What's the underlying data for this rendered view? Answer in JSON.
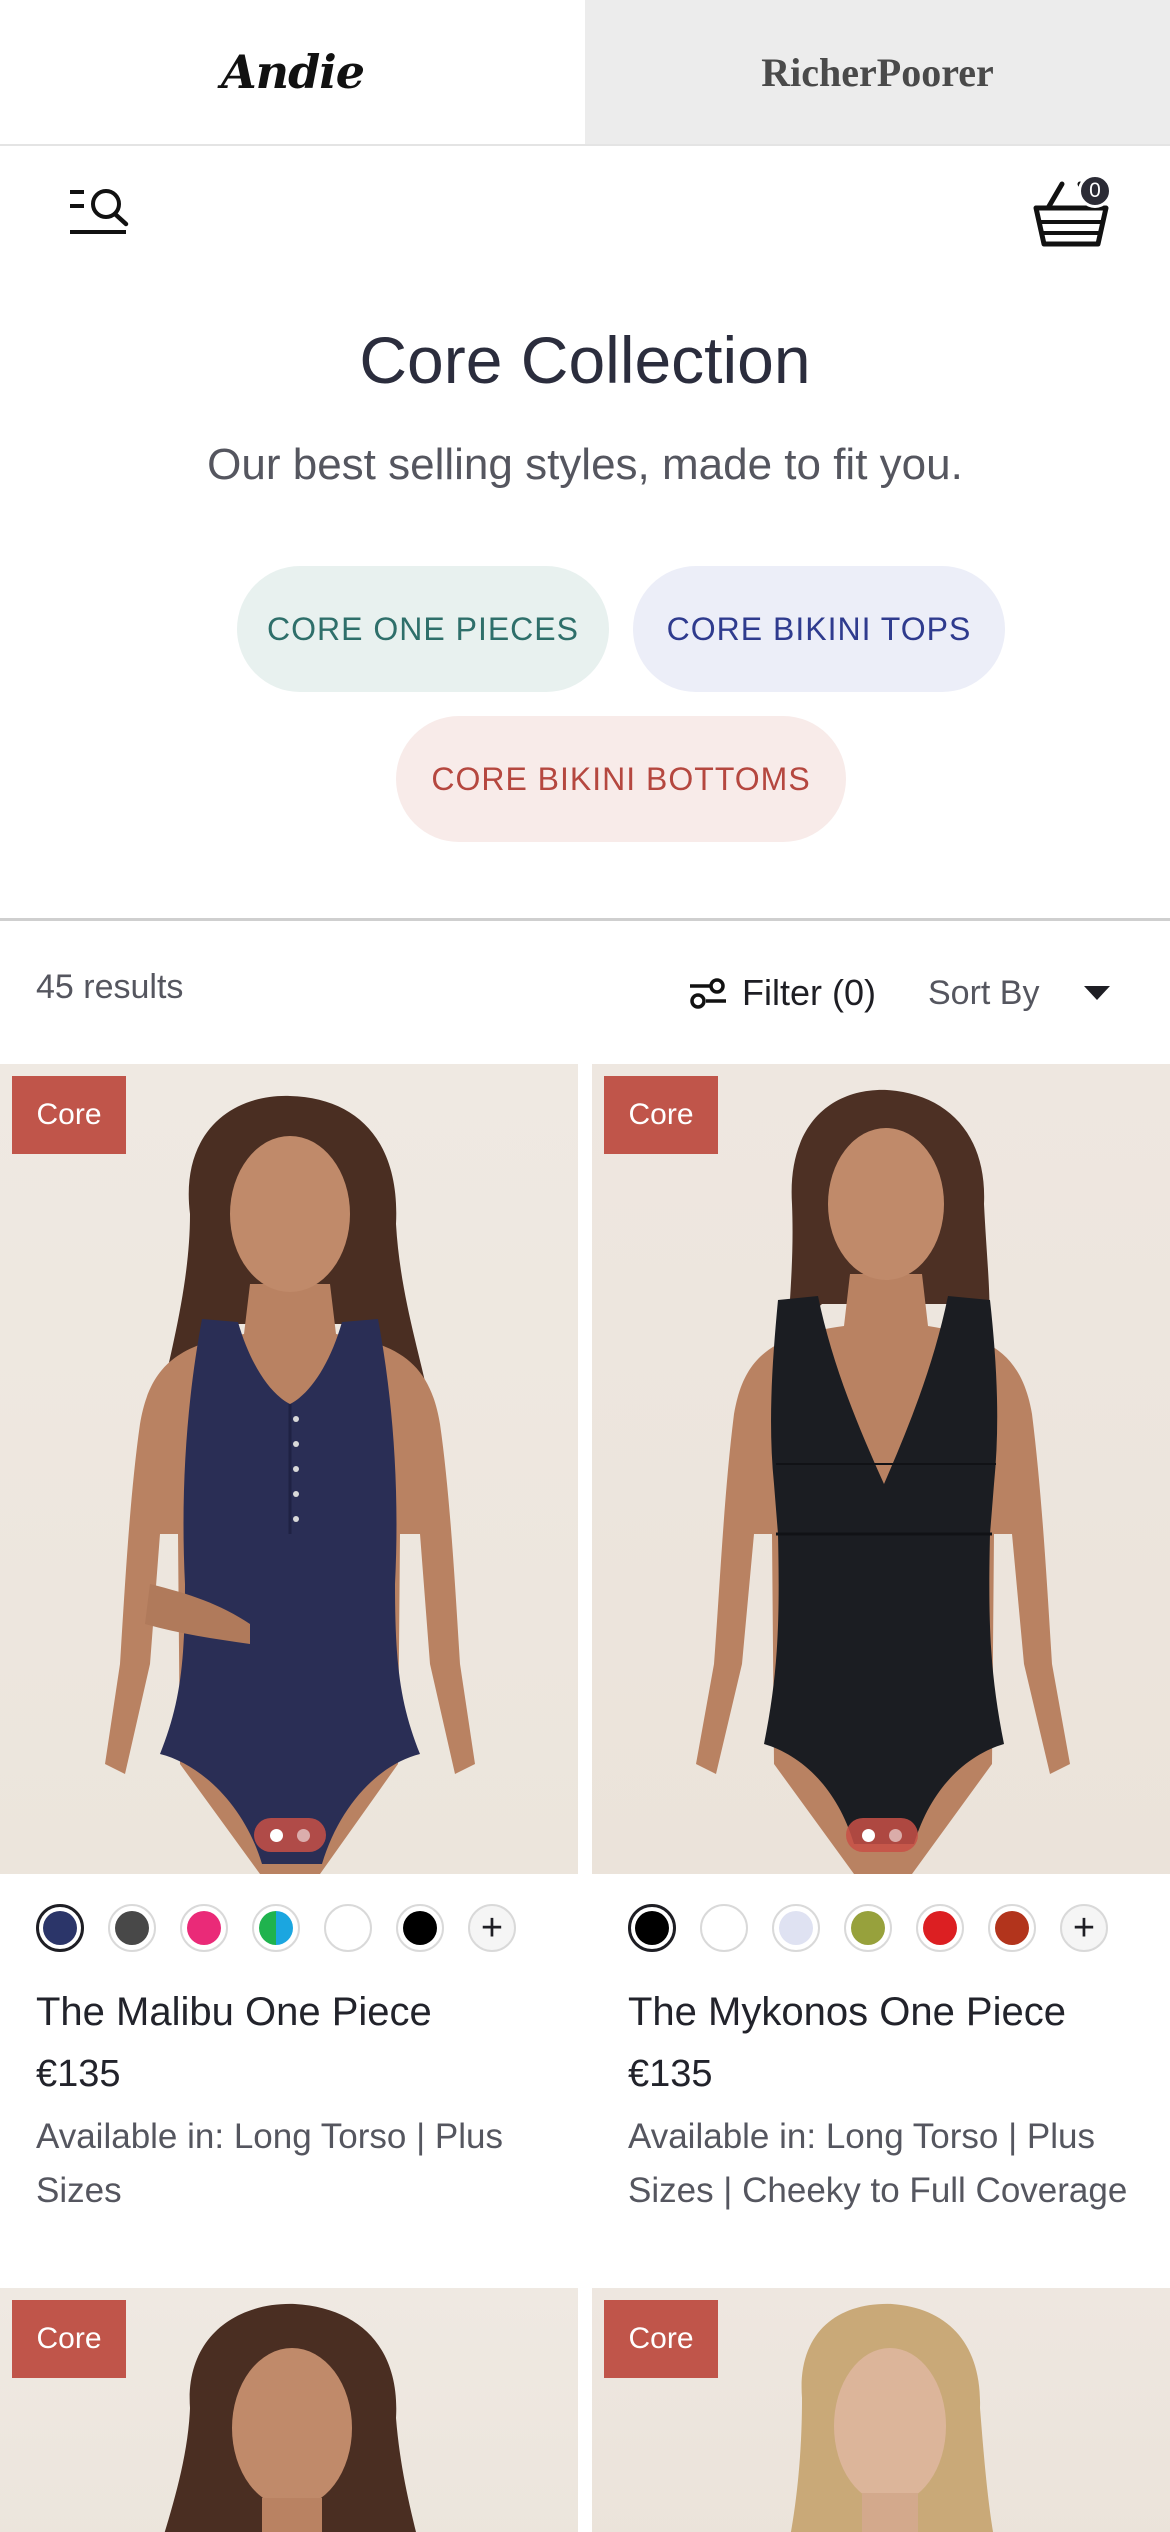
{
  "brand_tabs": {
    "andie": "Andie",
    "richerpoorer": "RicherPoorer"
  },
  "header": {
    "menu_icon": "menu-search-icon",
    "cart_icon": "basket-icon",
    "cart_count": "0"
  },
  "hero": {
    "title": "Core Collection",
    "subtitle": "Our best selling styles, made to fit you."
  },
  "categories": [
    {
      "label": "CORE ONE PIECES",
      "color": "#2e6f6a",
      "bg": "#e8f1ef"
    },
    {
      "label": "CORE BIKINI TOPS",
      "color": "#2f3b8e",
      "bg": "#eceef8"
    },
    {
      "label": "CORE BIKINI BOTTOMS",
      "color": "#b5473f",
      "bg": "#f8ebe9"
    }
  ],
  "toolbar": {
    "results": "45 results",
    "filter_label": "Filter (0)",
    "filter_icon": "sliders-icon",
    "sort_label": "Sort By"
  },
  "products": [
    {
      "badge": "Core",
      "name": "The Malibu One Piece",
      "price": "€135",
      "availability": "Available in: Long Torso | Plus Sizes",
      "swatches": [
        "#2b3569",
        "#484848",
        "#ea2a78",
        "#1fb34e",
        "#ffffff",
        "#000000"
      ],
      "more": "+",
      "garment_color": "#2a2e55"
    },
    {
      "badge": "Core",
      "name": "The Mykonos One Piece",
      "price": "€135",
      "availability": "Available in: Long Torso | Plus Sizes | Cheeky to Full Coverage",
      "swatches": [
        "#000000",
        "#ffffff",
        "#dfe2f2",
        "#97a13c",
        "#dc1f22",
        "#b2341c"
      ],
      "more": "+",
      "garment_color": "#1b1d22"
    },
    {
      "badge": "Core"
    },
    {
      "badge": "Core"
    }
  ]
}
